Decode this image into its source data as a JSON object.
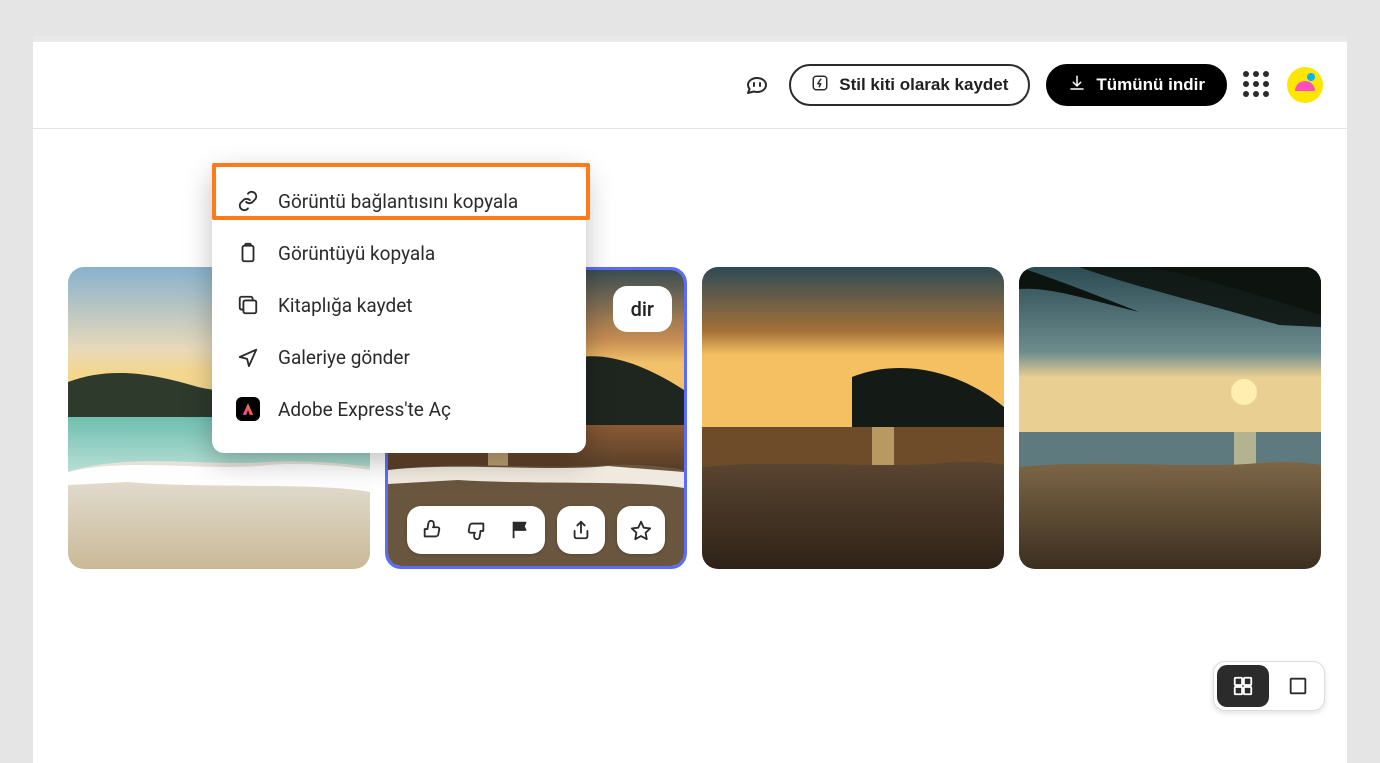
{
  "header": {
    "save_style_kit": "Stil kiti olarak kaydet",
    "download_all": "Tümünü indir"
  },
  "thumb_overlay": {
    "download_partial": "dir"
  },
  "context_menu": {
    "items": [
      {
        "label": "Görüntü bağlantısını kopyala"
      },
      {
        "label": "Görüntüyü kopyala"
      },
      {
        "label": "Kitaplığa kaydet"
      },
      {
        "label": "Galeriye gönder"
      },
      {
        "label": "Adobe Express'te Aç"
      }
    ]
  },
  "colors": {
    "highlight": "#ff7b1a",
    "selected_border": "#5a6cff"
  }
}
